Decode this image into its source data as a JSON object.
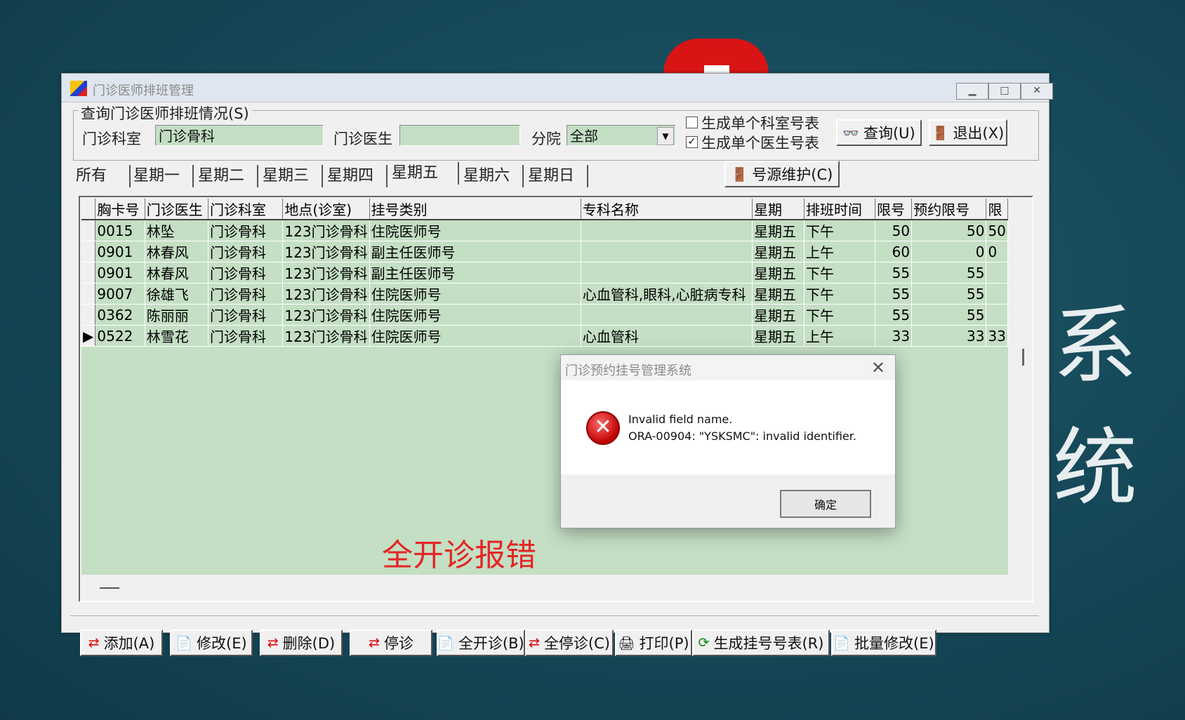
{
  "window": {
    "title": "门诊医师排班管理",
    "min": "▁",
    "max": "□",
    "close": "✕"
  },
  "query": {
    "group_label": "查询门诊医师排班情况(S)",
    "dept_label": "门诊科室",
    "dept_value": "门诊骨科",
    "doctor_label": "门诊医生",
    "doctor_value": "",
    "branch_label": "分院",
    "branch_value": "全部",
    "chk_dept_label": "生成单个科室号表",
    "chk_dept_checked": false,
    "chk_doctor_label": "生成单个医生号表",
    "chk_doctor_checked": true,
    "search_btn": "查询(U)",
    "exit_btn": "退出(X)",
    "source_btn": "号源维护(C)"
  },
  "tabs": [
    "所有",
    "星期一",
    "星期二",
    "星期三",
    "星期四",
    "星期五",
    "星期六",
    "星期日"
  ],
  "active_tab": "星期五",
  "table": {
    "headers": [
      "胸卡号",
      "门诊医生",
      "门诊科室",
      "地点(诊室)",
      "挂号类别",
      "专科名称",
      "星期",
      "排班时间",
      "限号",
      "预约限号",
      "限"
    ],
    "rows": [
      {
        "id": "0015",
        "doctor": "林坠",
        "dept": "门诊骨科",
        "place": "123门诊骨科",
        "type": "住院医师号",
        "spec": "",
        "week": "星期五",
        "time": "下午",
        "limit": "50",
        "book": "50",
        "x": "50"
      },
      {
        "id": "0901",
        "doctor": "林春风",
        "dept": "门诊骨科",
        "place": "123门诊骨科",
        "type": "副主任医师号",
        "spec": "",
        "week": "星期五",
        "time": "上午",
        "limit": "60",
        "book": "0",
        "x": "0"
      },
      {
        "id": "0901",
        "doctor": "林春风",
        "dept": "门诊骨科",
        "place": "123门诊骨科",
        "type": "副主任医师号",
        "spec": "",
        "week": "星期五",
        "time": "下午",
        "limit": "55",
        "book": "55",
        "x": ""
      },
      {
        "id": "9007",
        "doctor": "徐雄飞",
        "dept": "门诊骨科",
        "place": "123门诊骨科",
        "type": "住院医师号",
        "spec": "心血管科,眼科,心脏病专科",
        "week": "星期五",
        "time": "下午",
        "limit": "55",
        "book": "55",
        "x": ""
      },
      {
        "id": "0362",
        "doctor": "陈丽丽",
        "dept": "门诊骨科",
        "place": "123门诊骨科",
        "type": "住院医师号",
        "spec": "",
        "week": "星期五",
        "time": "下午",
        "limit": "55",
        "book": "55",
        "x": ""
      },
      {
        "id": "0522",
        "doctor": "林雪花",
        "dept": "门诊骨科",
        "place": "123门诊骨科",
        "type": "住院医师号",
        "spec": "心血管科",
        "week": "星期五",
        "time": "上午",
        "limit": "33",
        "book": "33",
        "x": "33"
      }
    ]
  },
  "bottom_buttons": [
    "添加(A)",
    "修改(E)",
    "删除(D)",
    "停诊",
    "全开诊(B)",
    "全停诊(C)",
    "打印(P)",
    "生成挂号号表(R)",
    "批量修改(E)"
  ],
  "annotation": "全开诊报错",
  "dialog": {
    "title": "门诊预约挂号管理系统",
    "line1": "Invalid field name.",
    "line2": "ORA-00904: \"YSKSMC\": invalid identifier.",
    "ok": "确定"
  },
  "background": {
    "text": "系统"
  }
}
